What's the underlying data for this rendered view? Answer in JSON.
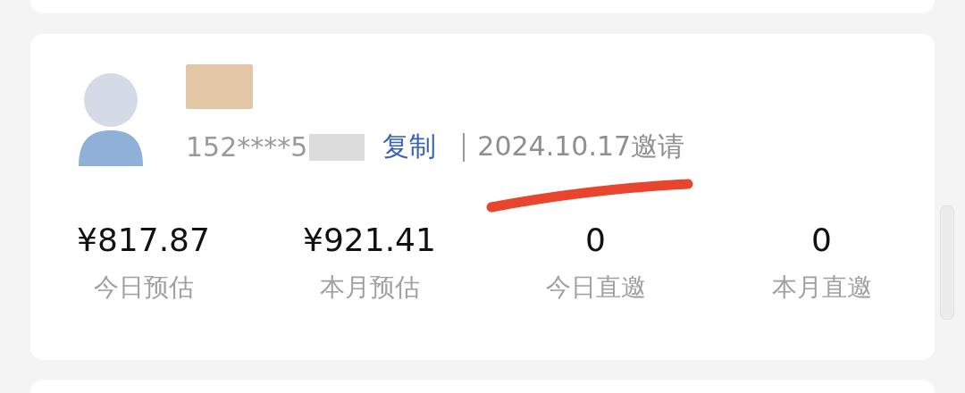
{
  "user": {
    "phone": "152****5",
    "copy_label": "复制",
    "invite_text": "2024.10.17邀请"
  },
  "stats": [
    {
      "value": "¥817.87",
      "label": "今日预估"
    },
    {
      "value": "¥921.41",
      "label": "本月预估"
    },
    {
      "value": "0",
      "label": "今日直邀"
    },
    {
      "value": "0",
      "label": "本月直邀"
    }
  ]
}
